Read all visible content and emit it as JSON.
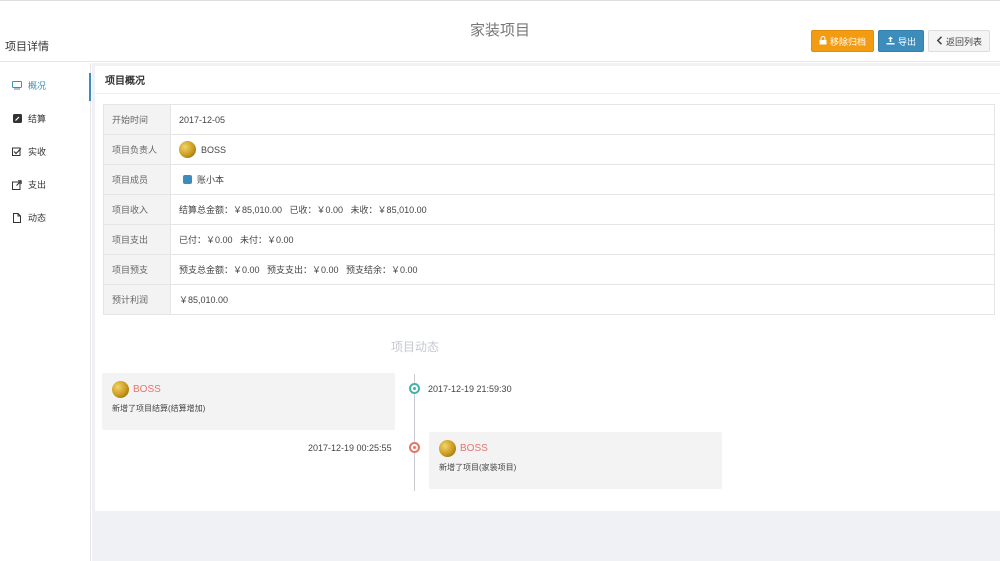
{
  "header": {
    "breadcrumb": "项目详情",
    "title": "家装项目",
    "buttons": {
      "archive": "移除归档",
      "export": "导出",
      "back": "返回列表"
    }
  },
  "sidebar": {
    "items": [
      {
        "label": "概况",
        "icon": "monitor-icon",
        "active": true
      },
      {
        "label": "结算",
        "icon": "edit-icon"
      },
      {
        "label": "实收",
        "icon": "check-square-icon"
      },
      {
        "label": "支出",
        "icon": "external-link-icon"
      },
      {
        "label": "动态",
        "icon": "file-icon"
      }
    ]
  },
  "overview": {
    "title": "项目概况",
    "rows": {
      "start": {
        "key": "开始时间",
        "value": "2017-12-05"
      },
      "owner": {
        "key": "项目负责人",
        "value": "BOSS"
      },
      "members": {
        "key": "项目成员",
        "value": "账小本"
      },
      "income": {
        "key": "项目收入",
        "value": "结算总金额：￥85,010.00   已收：￥0.00   未收：￥85,010.00"
      },
      "expense": {
        "key": "项目支出",
        "value": "已付：￥0.00   未付：￥0.00"
      },
      "budget": {
        "key": "项目预支",
        "value": "预支总金额：￥0.00   预支支出：￥0.00   预支结余：￥0.00"
      },
      "profit": {
        "key": "预计利润",
        "value": "￥85,010.00"
      }
    }
  },
  "timeline": {
    "title": "项目动态",
    "events": [
      {
        "time": "2017-12-19 21:59:30",
        "user": "BOSS",
        "text": "新增了项目结算(结算增加)",
        "color": "#3fb5ad"
      },
      {
        "time": "2017-12-19 00:25:55",
        "user": "BOSS",
        "text": "新增了项目(家装项目)",
        "color": "#e8736c"
      }
    ]
  },
  "colors": {
    "primary": "#3c8dbc",
    "warning": "#f39c12",
    "user_name": "#e8736c"
  }
}
